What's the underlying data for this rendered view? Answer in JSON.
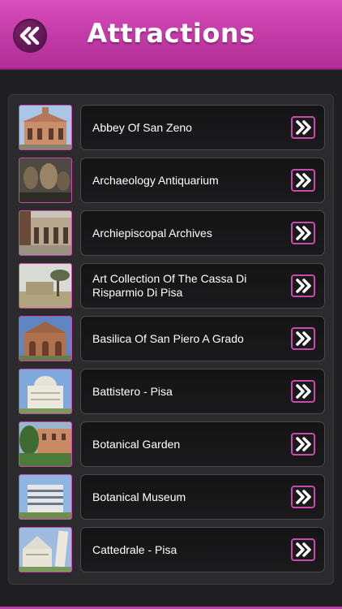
{
  "header": {
    "title": "Attractions",
    "back_icon": "double-chevron-left-icon",
    "color": "#c23aa6"
  },
  "list": {
    "arrow_icon": "double-chevron-right-icon",
    "items": [
      {
        "label": "Abbey Of San Zeno",
        "thumb": "abbey-photo"
      },
      {
        "label": "Archaeology Antiquarium",
        "thumb": "vases-photo"
      },
      {
        "label": "Archiepiscopal Archives",
        "thumb": "courtyard-photo"
      },
      {
        "label": "Art Collection Of The Cassa Di Risparmio Di Pisa",
        "thumb": "ruin-tree-photo"
      },
      {
        "label": "Basilica Of San Piero A Grado",
        "thumb": "basilica-photo"
      },
      {
        "label": "Battistero - Pisa",
        "thumb": "baptistery-photo"
      },
      {
        "label": "Botanical Garden",
        "thumb": "garden-photo"
      },
      {
        "label": "Botanical Museum",
        "thumb": "museum-photo"
      },
      {
        "label": "Cattedrale - Pisa",
        "thumb": "cathedral-photo"
      }
    ]
  }
}
